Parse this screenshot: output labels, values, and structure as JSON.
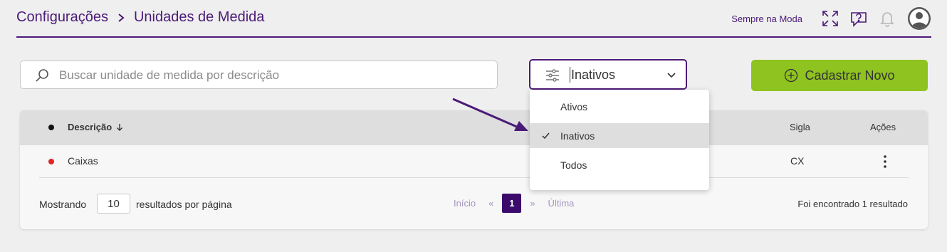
{
  "header": {
    "breadcrumb": [
      "Configurações",
      "Unidades de Medida"
    ],
    "store_name": "Sempre na Moda",
    "icons": [
      "fullscreen-icon",
      "help-icon",
      "bell-icon",
      "user-avatar-icon"
    ]
  },
  "search": {
    "placeholder": "Buscar unidade de medida por descrição",
    "value": ""
  },
  "filter": {
    "selected": "Inativos",
    "options": [
      {
        "label": "Ativos",
        "selected": false
      },
      {
        "label": "Inativos",
        "selected": true
      },
      {
        "label": "Todos",
        "selected": false
      }
    ]
  },
  "actions": {
    "new_label": "Cadastrar Novo"
  },
  "table": {
    "columns": {
      "descricao": "Descrição",
      "sigla": "Sigla",
      "acoes": "Ações"
    },
    "rows": [
      {
        "status": "inactive",
        "descricao": "Caixas",
        "sigla": "CX"
      }
    ]
  },
  "footer": {
    "showing_label": "Mostrando",
    "per_page": "10",
    "per_page_label": "resultados por página",
    "first": "Início",
    "prev": "«",
    "current_page": "1",
    "next": "»",
    "last": "Última",
    "found_text": "Foi encontrado 1 resultado"
  },
  "colors": {
    "brand": "#4b1a78",
    "accent_green": "#8fc31f",
    "status_inactive": "#e02424",
    "page_active": "#3c0a6b"
  }
}
